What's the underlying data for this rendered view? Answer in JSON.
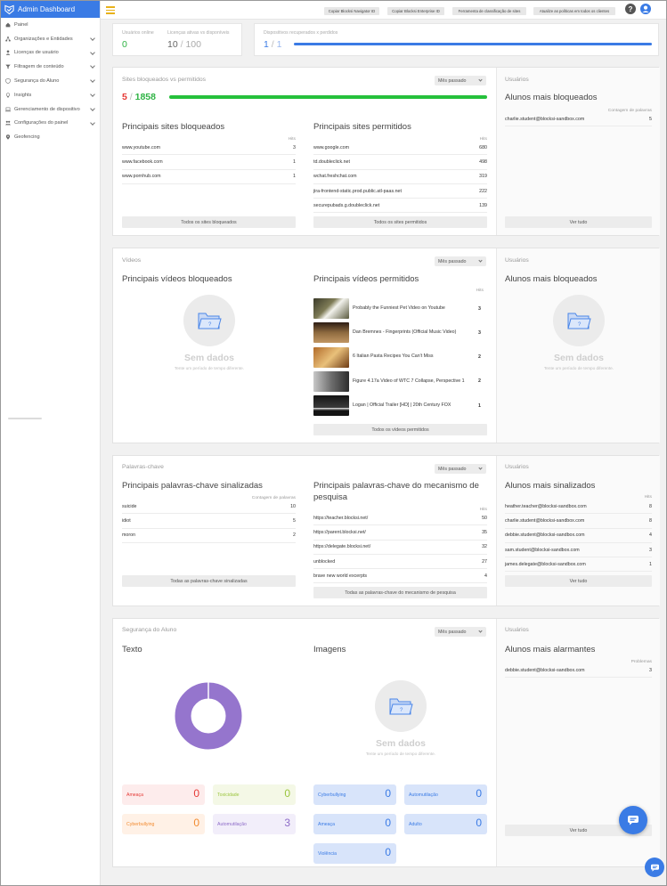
{
  "app": {
    "title": "Admin Dashboard"
  },
  "sidebar": {
    "items": [
      {
        "label": "Painel",
        "icon": "home-icon",
        "has_chevron": false
      },
      {
        "label": "Organizações e Entidades",
        "icon": "org-icon",
        "has_chevron": true
      },
      {
        "label": "Licenças de usuário",
        "icon": "user-icon",
        "has_chevron": true
      },
      {
        "label": "Filtragem de conteúdo",
        "icon": "filter-icon",
        "has_chevron": true
      },
      {
        "label": "Segurança do Aluno",
        "icon": "shield-icon",
        "has_chevron": true
      },
      {
        "label": "Insights",
        "icon": "lightbulb-icon",
        "has_chevron": true
      },
      {
        "label": "Gerenciamento de dispositivo",
        "icon": "laptop-icon",
        "has_chevron": true
      },
      {
        "label": "Configurações do painel",
        "icon": "people-icon",
        "has_chevron": true
      },
      {
        "label": "Geofencing",
        "icon": "location-icon",
        "has_chevron": false
      }
    ]
  },
  "topbar": {
    "buttons": [
      "Copiar Blocksi Navigator ID",
      "Copiar Blocksi Enterprise ID",
      "Ferramenta de classificação de sites",
      "Atualize as políticas em todos os clientes"
    ]
  },
  "stats": {
    "online_label": "Usuários online",
    "online_value": "0",
    "licenses_label": "Licenças ativas vs disponíveis",
    "licenses_active": "10",
    "licenses_sep": " / ",
    "licenses_total": "100",
    "devices_label": "Dispositivos recuperados x perdidos",
    "devices_recovered": "1",
    "devices_sep": " / ",
    "devices_lost": "1",
    "devices_fill": 1.0
  },
  "colors": {
    "accent": "#3a7be5",
    "red": "#e53935",
    "green": "#2fb344",
    "bar_green": "#25c13b",
    "purple": "#9575cd",
    "gold": "#e8b21b"
  },
  "sites": {
    "title": "Sites bloqueados vs permitidos",
    "period": "Mês passado",
    "blocked_count": "5",
    "sep": " / ",
    "allowed_count": "1858",
    "top_blocked_title": "Principais sites bloqueados",
    "hits_label": "Hits",
    "top_blocked": [
      {
        "site": "www.youtube.com",
        "hits": "3"
      },
      {
        "site": "www.facebook.com",
        "hits": "1"
      },
      {
        "site": "www.pornhub.com",
        "hits": "1"
      }
    ],
    "all_blocked_btn": "Todos os sites bloqueados",
    "top_allowed_title": "Principais sites permitidos",
    "top_allowed": [
      {
        "site": "www.google.com",
        "hits": "680"
      },
      {
        "site": "td.doubleclick.net",
        "hits": "498"
      },
      {
        "site": "wchat.freshchat.com",
        "hits": "319"
      },
      {
        "site": "jira-frontend-static.prod.public.atl-paas.net",
        "hits": "222"
      },
      {
        "site": "securepubads.g.doubleclick.net",
        "hits": "139"
      }
    ],
    "all_allowed_btn": "Todos os sites permitidos"
  },
  "users1": {
    "title": "Usuários",
    "subtitle": "Alunos mais bloqueados",
    "col": "Contagem de palavras",
    "rows": [
      {
        "email": "charlie.student@blocksi-sandbox.com",
        "n": "5"
      }
    ],
    "btn": "Ver tudo"
  },
  "videos": {
    "title": "Vídeos",
    "period": "Mês passado",
    "blocked_title": "Principais vídeos bloqueados",
    "nodata_title": "Sem dados",
    "nodata_sub": "Tente um período de tempo diferente.",
    "allowed_title": "Principais vídeos permitidos",
    "hits_label": "Hits",
    "allowed": [
      {
        "title": "Probably the Funniest Pet Video on Youtube",
        "hits": "3"
      },
      {
        "title": "Dan Bremnes - Fingerprints (Official Music Video)",
        "hits": "3"
      },
      {
        "title": "6 Italian Pasta Recipes You Can't Miss",
        "hits": "2"
      },
      {
        "title": "Figure 4.17a Video of WTC 7 Collapse, Perspective 1",
        "hits": "2"
      },
      {
        "title": "Logan | Official Trailer [HD] | 20th Century FOX",
        "hits": "1"
      }
    ],
    "all_btn": "Todos os vídeos permitidos"
  },
  "users2": {
    "title": "Usuários",
    "subtitle": "Alunos mais bloqueados",
    "nodata_title": "Sem dados",
    "nodata_sub": "Tente um período de tempo diferente."
  },
  "keywords": {
    "title": "Palavras-chave",
    "period": "Mês passado",
    "flagged_title": "Principais palavras-chave sinalizadas",
    "flagged_col": "Contagem de palavras",
    "flagged": [
      {
        "word": "suicide",
        "n": "10"
      },
      {
        "word": "idiot",
        "n": "5"
      },
      {
        "word": "moron",
        "n": "2"
      }
    ],
    "flagged_btn": "Todas as palavras-chave sinalizadas",
    "search_title": "Principais palavras-chave do mecanismo de pesquisa",
    "hits_label": "Hits",
    "search": [
      {
        "word": "https://teacher.blocksi.net/",
        "n": "50"
      },
      {
        "word": "https://parent.blocksi.net/",
        "n": "35"
      },
      {
        "word": "https://delegate.blocksi.net/",
        "n": "32"
      },
      {
        "word": "unblocked",
        "n": "27"
      },
      {
        "word": "brave new world excerpts",
        "n": "4"
      }
    ],
    "search_btn": "Todas as palavras-chave do mecanismo de pesquisa"
  },
  "users3": {
    "title": "Usuários",
    "subtitle": "Alunos mais sinalizados",
    "col": "Hits",
    "rows": [
      {
        "email": "heather.teacher@blocksi-sandbox.com",
        "n": "8"
      },
      {
        "email": "charlie.student@blocksi-sandbox.com",
        "n": "8"
      },
      {
        "email": "debbie.student@blocksi-sandbox.com",
        "n": "4"
      },
      {
        "email": "sam.student@blocksi-sandbox.com",
        "n": "3"
      },
      {
        "email": "james.delegate@blocksi-sandbox.com",
        "n": "1"
      }
    ],
    "btn": "Ver tudo"
  },
  "safety": {
    "title": "Segurança do Aluno",
    "period": "Mês passado",
    "text_title": "Texto",
    "images_title": "Imagens",
    "nodata_title": "Sem dados",
    "nodata_sub": "Tente um período de tempo diferente.",
    "text_tiles": [
      {
        "label": "Ameaça",
        "value": "0"
      },
      {
        "label": "Toxicidade",
        "value": "0"
      },
      {
        "label": "Cyberbullying",
        "value": "0"
      },
      {
        "label": "Automutilação",
        "value": "3"
      }
    ],
    "image_tiles": [
      {
        "label": "Cyberbullying",
        "value": "0"
      },
      {
        "label": "Automutilação",
        "value": "0"
      },
      {
        "label": "Ameaça",
        "value": "0"
      },
      {
        "label": "Adulto",
        "value": "0"
      },
      {
        "label": "Violência",
        "value": "0"
      }
    ]
  },
  "users4": {
    "title": "Usuários",
    "subtitle": "Alunos mais alarmantes",
    "col": "Problemas",
    "rows": [
      {
        "email": "debbie.student@blocksi-sandbox.com",
        "n": "3"
      }
    ],
    "btn": "Ver tudo"
  }
}
